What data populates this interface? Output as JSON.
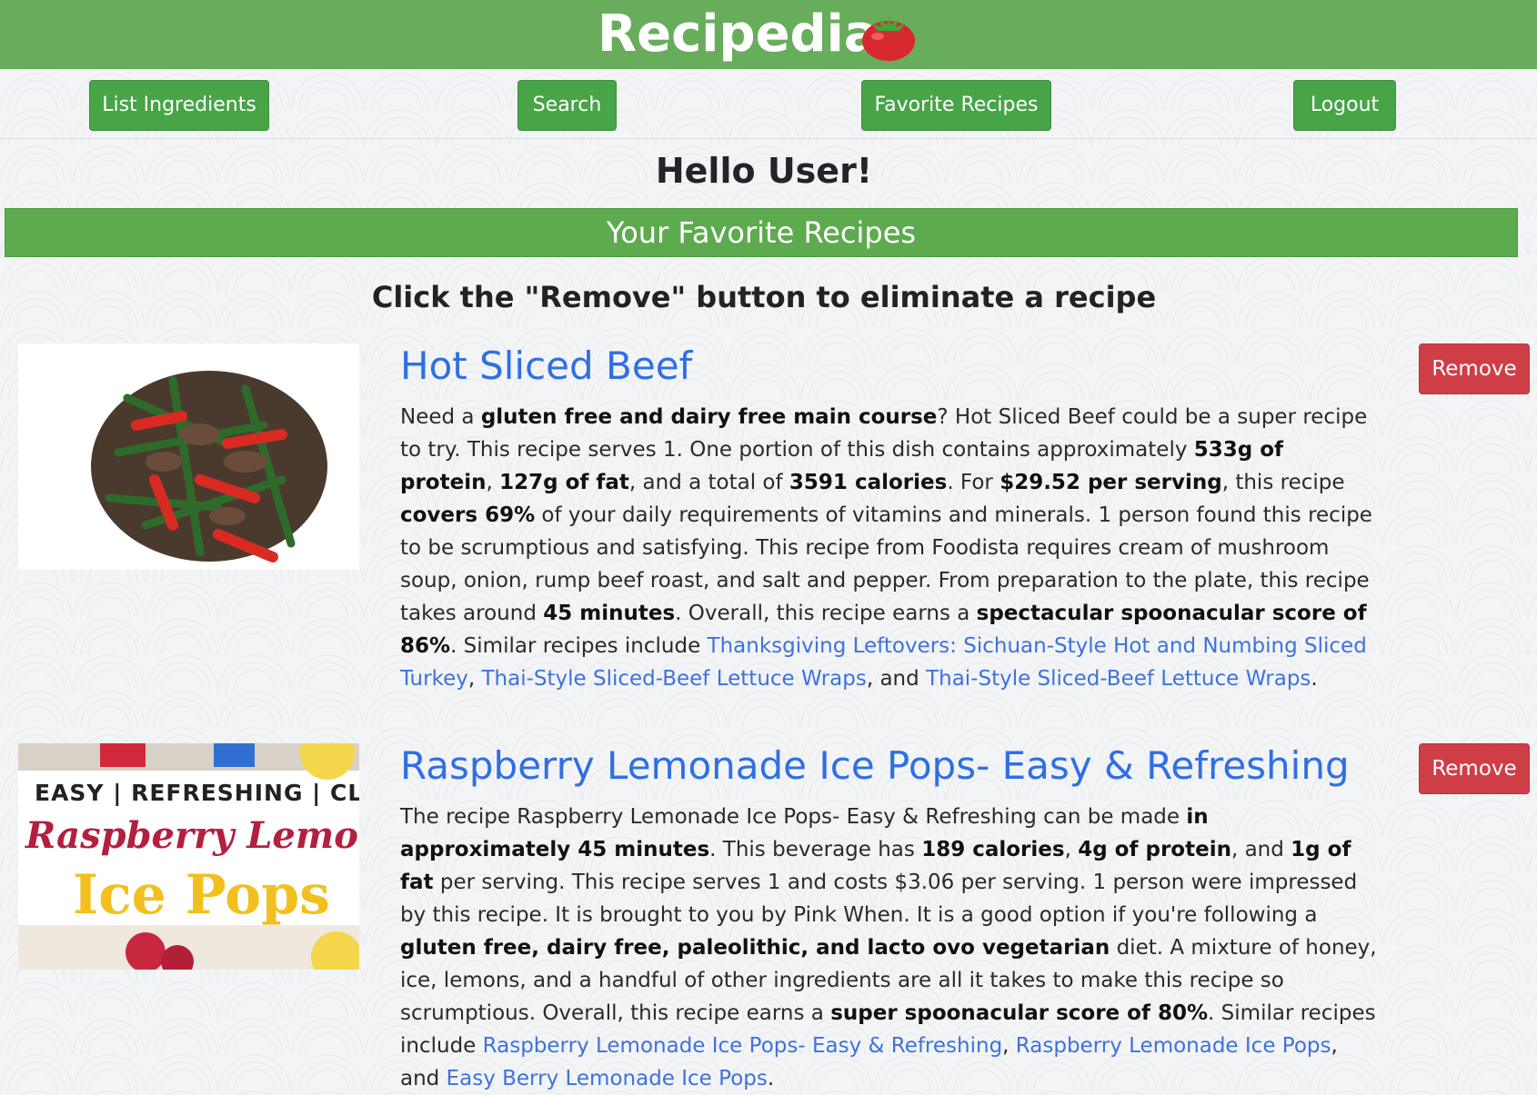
{
  "brand": {
    "title": "Recipedia"
  },
  "nav": {
    "list_ingredients": "List Ingredients",
    "search": "Search",
    "favorite_recipes": "Favorite Recipes",
    "logout": "Logout"
  },
  "greeting": "Hello User!",
  "section_title": "Your Favorite Recipes",
  "instructions": "Click the \"Remove\" button to eliminate a recipe",
  "recipes": [
    {
      "title": "Hot Sliced Beef",
      "remove_label": "Remove",
      "summary": [
        {
          "t": "Need a "
        },
        {
          "t": "gluten free and dairy free main course",
          "b": true
        },
        {
          "t": "? Hot Sliced Beef could be a super recipe to try. This recipe serves 1. One portion of this dish contains approximately "
        },
        {
          "t": "533g of protein",
          "b": true
        },
        {
          "t": ", "
        },
        {
          "t": "127g of fat",
          "b": true
        },
        {
          "t": ", and a total of "
        },
        {
          "t": "3591 calories",
          "b": true
        },
        {
          "t": ". For "
        },
        {
          "t": "$29.52 per serving",
          "b": true
        },
        {
          "t": ", this recipe "
        },
        {
          "t": "covers 69%",
          "b": true
        },
        {
          "t": " of your daily requirements of vitamins and minerals. 1 person found this recipe to be scrumptious and satisfying. This recipe from Foodista requires cream of mushroom soup, onion, rump beef roast, and salt and pepper. From preparation to the plate, this recipe takes around "
        },
        {
          "t": "45 minutes",
          "b": true
        },
        {
          "t": ". Overall, this recipe earns a "
        },
        {
          "t": "spectacular spoonacular score of 86%",
          "b": true
        },
        {
          "t": ". Similar recipes include "
        },
        {
          "t": "Thanksgiving Leftovers: Sichuan-Style Hot and Numbing Sliced Turkey",
          "link": true
        },
        {
          "t": ", "
        },
        {
          "t": "Thai-Style Sliced-Beef Lettuce Wraps",
          "link": true
        },
        {
          "t": ", and "
        },
        {
          "t": "Thai-Style Sliced-Beef Lettuce Wraps",
          "link": true
        },
        {
          "t": "."
        }
      ]
    },
    {
      "title": "Raspberry Lemonade Ice Pops- Easy & Refreshing",
      "remove_label": "Remove",
      "image_text": {
        "line1": "EASY | REFRESHING | CLEAN",
        "line2": "Raspberry Lemonade",
        "line3": "Ice Pops"
      },
      "summary": [
        {
          "t": "The recipe Raspberry Lemonade Ice Pops- Easy & Refreshing can be made "
        },
        {
          "t": "in approximately 45 minutes",
          "b": true
        },
        {
          "t": ". This beverage has "
        },
        {
          "t": "189 calories",
          "b": true
        },
        {
          "t": ", "
        },
        {
          "t": "4g of protein",
          "b": true
        },
        {
          "t": ", and "
        },
        {
          "t": "1g of fat",
          "b": true
        },
        {
          "t": " per serving. This recipe serves 1 and costs $3.06 per serving. 1 person were impressed by this recipe. It is brought to you by Pink When. It is a good option if you're following a "
        },
        {
          "t": "gluten free, dairy free, paleolithic, and lacto ovo vegetarian",
          "b": true
        },
        {
          "t": " diet. A mixture of honey, ice, lemons, and a handful of other ingredients are all it takes to make this recipe so scrumptious. Overall, this recipe earns a "
        },
        {
          "t": "super spoonacular score of 80%",
          "b": true
        },
        {
          "t": ". Similar recipes include "
        },
        {
          "t": "Raspberry Lemonade Ice Pops- Easy & Refreshing",
          "link": true
        },
        {
          "t": ", "
        },
        {
          "t": "Raspberry Lemonade Ice Pops",
          "link": true
        },
        {
          "t": ", and "
        },
        {
          "t": "Easy Berry Lemonade Ice Pops",
          "link": true
        },
        {
          "t": "."
        }
      ]
    }
  ]
}
